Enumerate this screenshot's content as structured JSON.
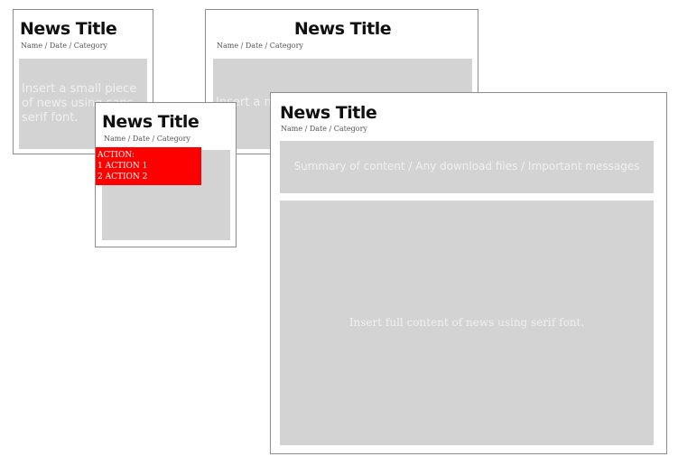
{
  "cards": [
    {
      "title": "News Title",
      "meta": "Name / Date / Category",
      "body": "Insert a small piece of news using sans serif font."
    },
    {
      "title": "News Title",
      "meta": "Name / Date / Category",
      "body": "Insert a medium piece of news using sans serif font."
    },
    {
      "title": "News Title",
      "meta": "Name / Date / Category",
      "action": {
        "header": "ACTION:",
        "items": [
          "1 ACTION 1",
          "2 ACTION 2"
        ]
      }
    },
    {
      "title": "News Title",
      "meta": "Name / Date / Category",
      "summary": "Summary of content / Any download files / Important messages",
      "content": "Insert full content of news using serif font."
    }
  ],
  "colors": {
    "card_border": "#8d8d8d",
    "placeholder": "#d3d3d3",
    "placeholder_text": "#f0f0f0",
    "action_bg": "#ff0000",
    "action_text": "#ffffff"
  }
}
